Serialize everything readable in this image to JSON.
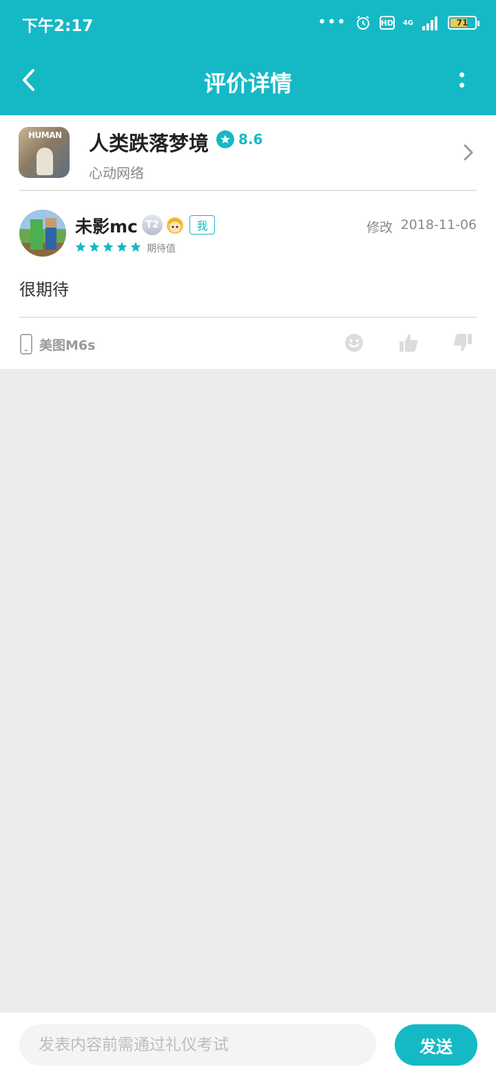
{
  "status_bar": {
    "time": "下午2:17",
    "dots": "•••",
    "hd": "HD",
    "network": "4G",
    "battery": "71",
    "battery_level": 0.71
  },
  "header": {
    "title": "评价详情"
  },
  "game": {
    "icon_text": "HUMAN",
    "name": "人类跌落梦境",
    "rating": "8.6",
    "developer": "心动网络"
  },
  "review": {
    "username": "未影mc",
    "level": "T2",
    "me_tag": "我",
    "edit_label": "修改",
    "date": "2018-11-06",
    "star_count": 5,
    "stars_label": "期待值",
    "text": "很期待",
    "device": "美图M6s"
  },
  "comment_bar": {
    "placeholder": "发表内容前需通过礼仪考试",
    "send_label": "发送"
  },
  "colors": {
    "accent": "#15b9c6",
    "background": "#ececec"
  },
  "icons": [
    "back-arrow-icon",
    "more-icon",
    "star-icon",
    "chevron-right-icon",
    "phone-icon",
    "emoji-icon",
    "like-icon",
    "dislike-icon",
    "alarm-icon",
    "signal-icon",
    "battery-icon"
  ]
}
